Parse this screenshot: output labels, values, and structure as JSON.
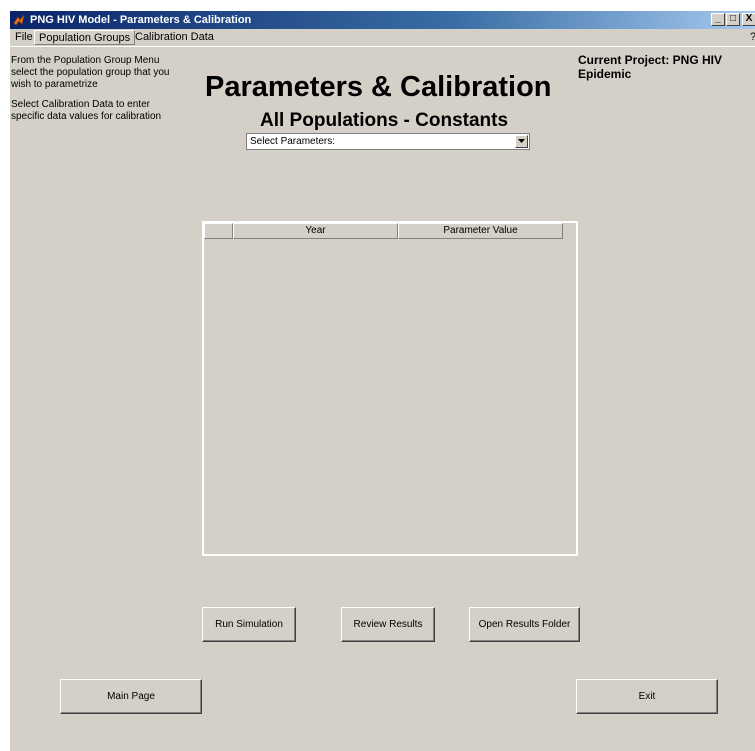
{
  "window": {
    "title": "PNG HIV Model - Parameters & Calibration",
    "controls": {
      "minimize": "_",
      "restore": "□",
      "close": "X"
    }
  },
  "menubar": {
    "items": [
      {
        "label": "File"
      },
      {
        "label": "Population Groups"
      },
      {
        "label": "Calibration Data"
      }
    ],
    "help_mark": "?"
  },
  "help_text": {
    "line1": "From the Population Group  Menu",
    "line2": "select the population group that you",
    "line3": "wish to parametrize",
    "line4": "Select Calibration Data to enter",
    "line5": "specific data values for calibration"
  },
  "header": {
    "title": "Parameters & Calibration",
    "subtitle": "All Populations - Constants"
  },
  "project": {
    "line1": "Current Project: PNG HIV",
    "line2": "Epidemic"
  },
  "param_select": {
    "selected": "Select Parameters:"
  },
  "table": {
    "columns": [
      "",
      "Year",
      "Parameter Value"
    ]
  },
  "buttons": {
    "run_simulation": "Run Simulation",
    "review_results": "Review Results",
    "open_results_folder": "Open Results Folder",
    "main_page": "Main Page",
    "exit": "Exit"
  }
}
